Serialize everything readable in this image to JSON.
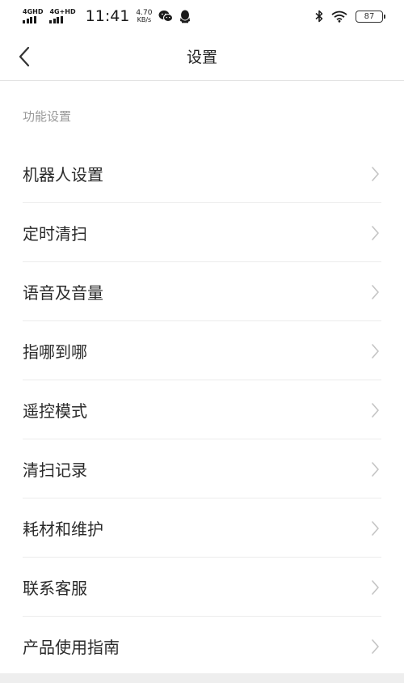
{
  "status_bar": {
    "net1": "4GHD",
    "net2": "4G+HD",
    "time": "11:41",
    "speed_value": "4.70",
    "speed_unit": "KB/s",
    "battery": "87"
  },
  "header": {
    "title": "设置"
  },
  "section": {
    "title": "功能设置"
  },
  "menu": {
    "items": [
      {
        "label": "机器人设置"
      },
      {
        "label": "定时清扫"
      },
      {
        "label": "语音及音量"
      },
      {
        "label": "指哪到哪"
      },
      {
        "label": "遥控模式"
      },
      {
        "label": "清扫记录"
      },
      {
        "label": "耗材和维护"
      },
      {
        "label": "联系客服"
      },
      {
        "label": "产品使用指南"
      }
    ]
  },
  "icons": {
    "back": "chevron-left-icon",
    "row_arrow": "chevron-right-icon",
    "wechat": "wechat-icon",
    "qq": "qq-icon",
    "bluetooth": "bluetooth-icon",
    "wifi": "wifi-icon"
  }
}
